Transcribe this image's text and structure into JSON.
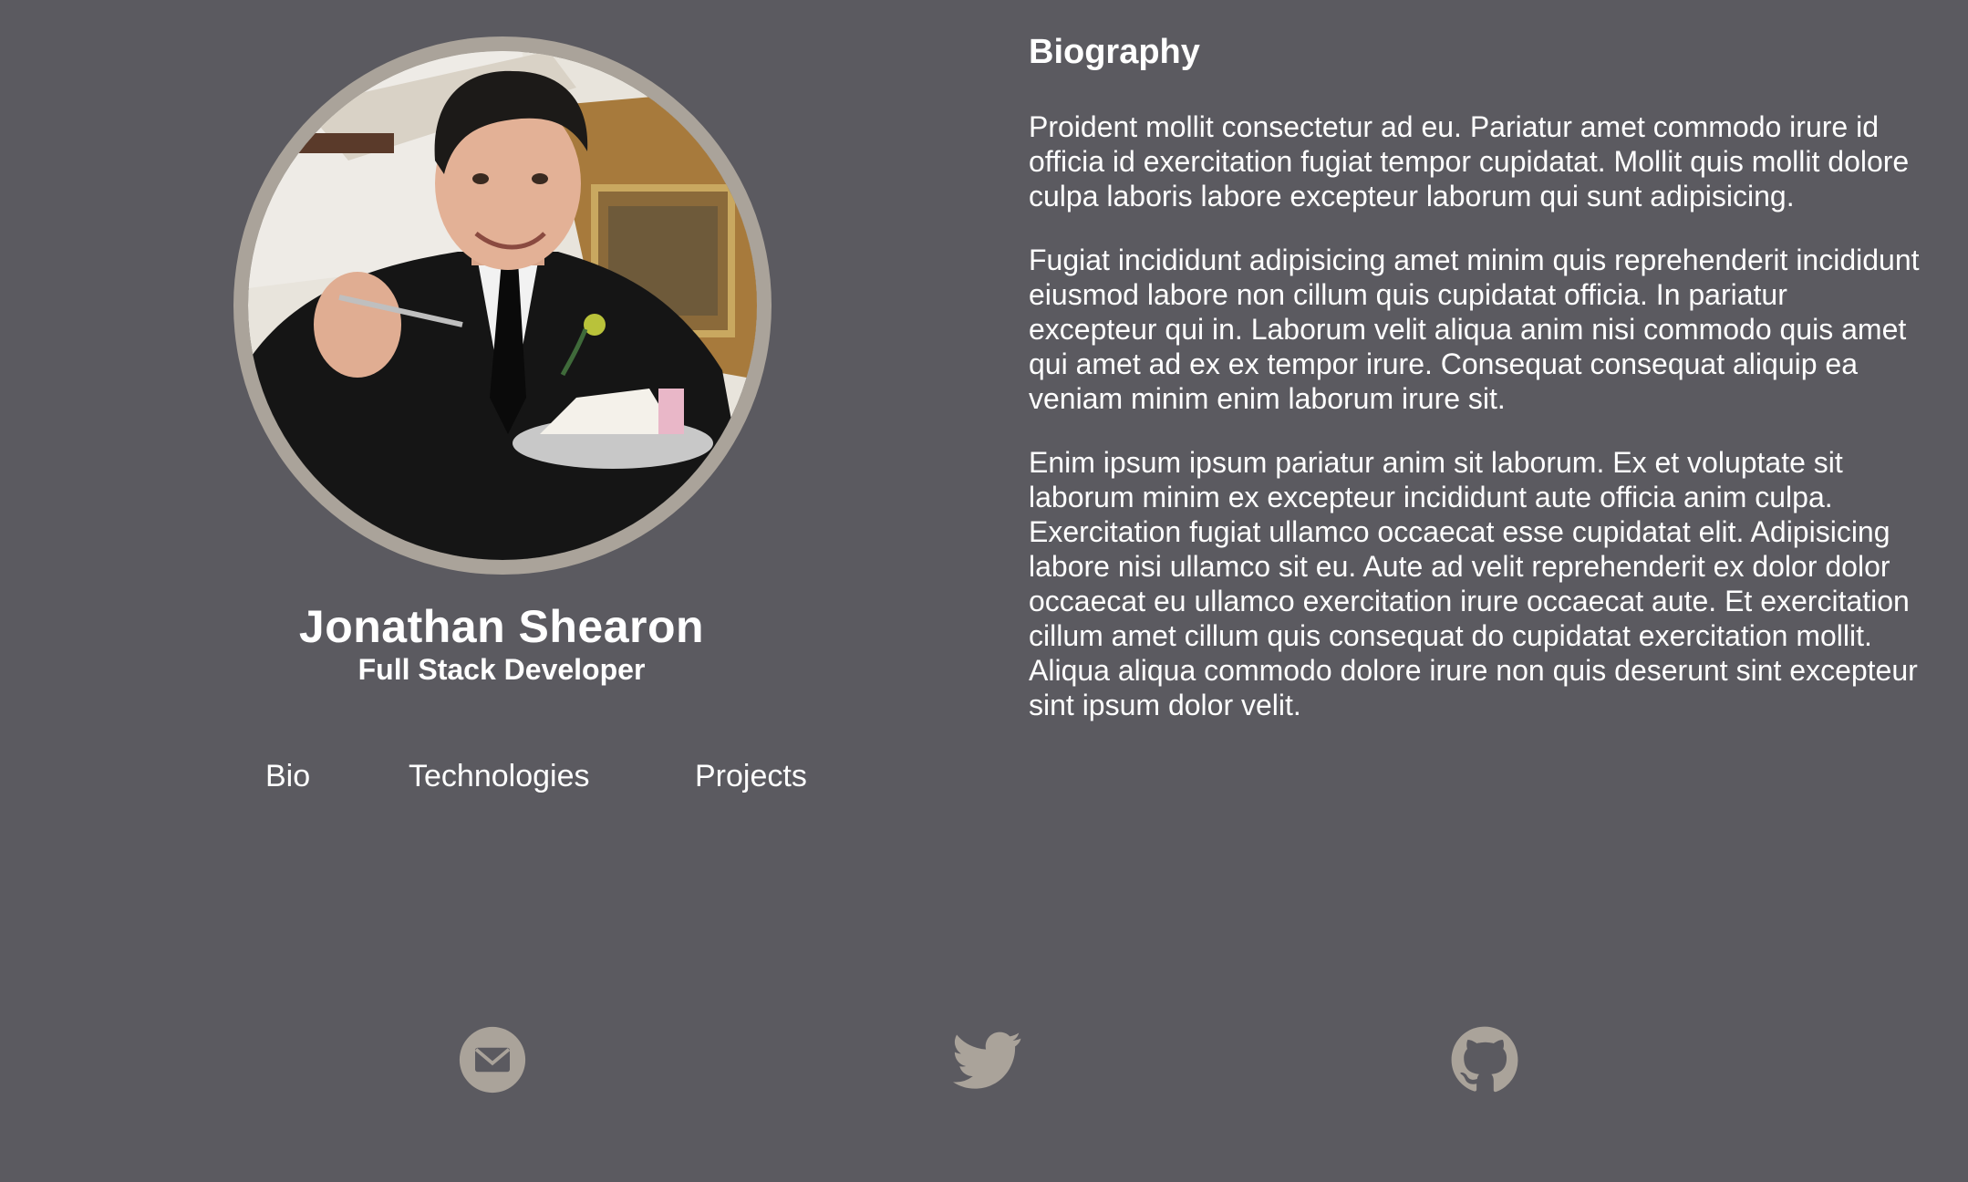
{
  "profile": {
    "name": "Jonathan Shearon",
    "role": "Full Stack Developer",
    "photo_alt": "Profile photo"
  },
  "nav": {
    "items": [
      {
        "label": "Bio"
      },
      {
        "label": "Technologies"
      },
      {
        "label": "Projects"
      }
    ]
  },
  "biography": {
    "title": "Biography",
    "paragraphs": [
      "Proident mollit consectetur ad eu. Pariatur amet commodo irure id officia id exercitation fugiat tempor cupidatat. Mollit quis mollit dolore culpa laboris labore excepteur laborum qui sunt adipisicing.",
      "Fugiat incididunt adipisicing amet minim quis reprehenderit incididunt eiusmod labore non cillum quis cupidatat officia. In pariatur excepteur qui in. Laborum velit aliqua anim nisi commodo quis amet qui amet ad ex ex tempor irure. Consequat consequat aliquip ea veniam minim enim laborum irure sit.",
      "Enim ipsum ipsum pariatur anim sit laborum. Ex et voluptate sit laborum minim ex excepteur incididunt aute officia anim culpa. Exercitation fugiat ullamco occaecat esse cupidatat elit. Adipisicing labore nisi ullamco sit eu. Aute ad velit reprehenderit ex dolor dolor occaecat eu ullamco exercitation irure occaecat aute. Et exercitation cillum amet cillum quis consequat do cupidatat exercitation mollit. Aliqua aliqua commodo dolore irure non quis deserunt sint excepteur sint ipsum dolor velit."
    ]
  },
  "social": {
    "icons": [
      "mail-icon",
      "twitter-icon",
      "github-icon"
    ]
  },
  "colors": {
    "background": "#5b5a60",
    "accent": "#aaa39a",
    "text": "#ffffff"
  }
}
